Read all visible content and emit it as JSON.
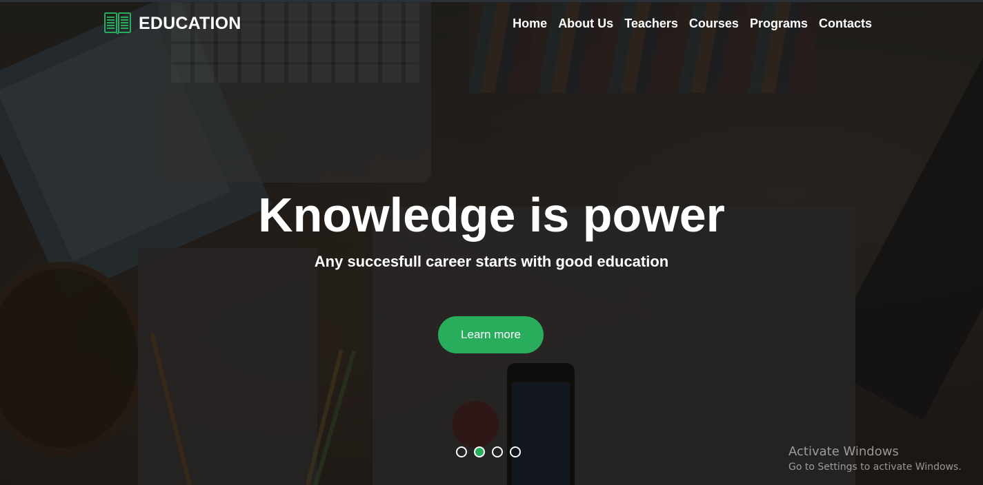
{
  "header": {
    "brand": "EDUCATION",
    "logo_icon": "open-book-icon",
    "accent_color": "#28ad5c",
    "nav": [
      {
        "label": "Home"
      },
      {
        "label": "About Us"
      },
      {
        "label": "Teachers"
      },
      {
        "label": "Courses"
      },
      {
        "label": "Programs"
      },
      {
        "label": "Contacts"
      }
    ]
  },
  "hero": {
    "title": "Knowledge is power",
    "subtitle": "Any succesfull career starts with good education",
    "cta_label": "Learn more",
    "carousel": {
      "slides": 4,
      "active_index": 1
    }
  },
  "watermark": {
    "title": "Activate Windows",
    "subtitle": "Go to Settings to activate Windows."
  }
}
